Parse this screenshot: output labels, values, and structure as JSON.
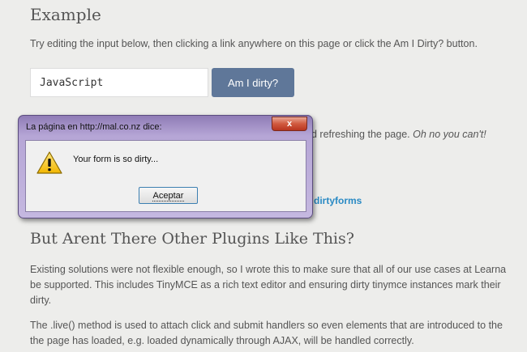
{
  "example": {
    "heading": "Example",
    "intro": "Try editing the input below, then clicking a link anywhere on this page or click the Am I Dirty? button.",
    "input_value": "JavaScript",
    "button_label": "Am I dirty?"
  },
  "behind_dialog": {
    "text": "d refreshing the page. ",
    "italic": "Oh no you can't!",
    "link_fragment": "dirtyforms"
  },
  "dialog": {
    "title": "La página en http://mal.co.nz dice:",
    "close_label": "x",
    "message": "Your form is so dirty...",
    "accept_label": "Aceptar",
    "icon": "warning-icon"
  },
  "plugins": {
    "heading": "But Arent There Other Plugins Like This?",
    "para1_line1": "Existing solutions were not flexible enough, so I wrote this to make sure that all of our use cases at Learna",
    "para1_line2": "be supported. This includes TinyMCE as a rich text editor and ensuring dirty tinymce instances mark their",
    "para1_line3": "dirty.",
    "para2_line1": "The .live() method is used to attach click and submit handlers so even elements that are introduced to the",
    "para2_line2": "the page has loaded, e.g. loaded dynamically through AJAX, will be handled correctly."
  },
  "colors": {
    "button": "#5f7799",
    "link": "#2a8ac4",
    "dialog_frame": "#b6a6d6"
  }
}
